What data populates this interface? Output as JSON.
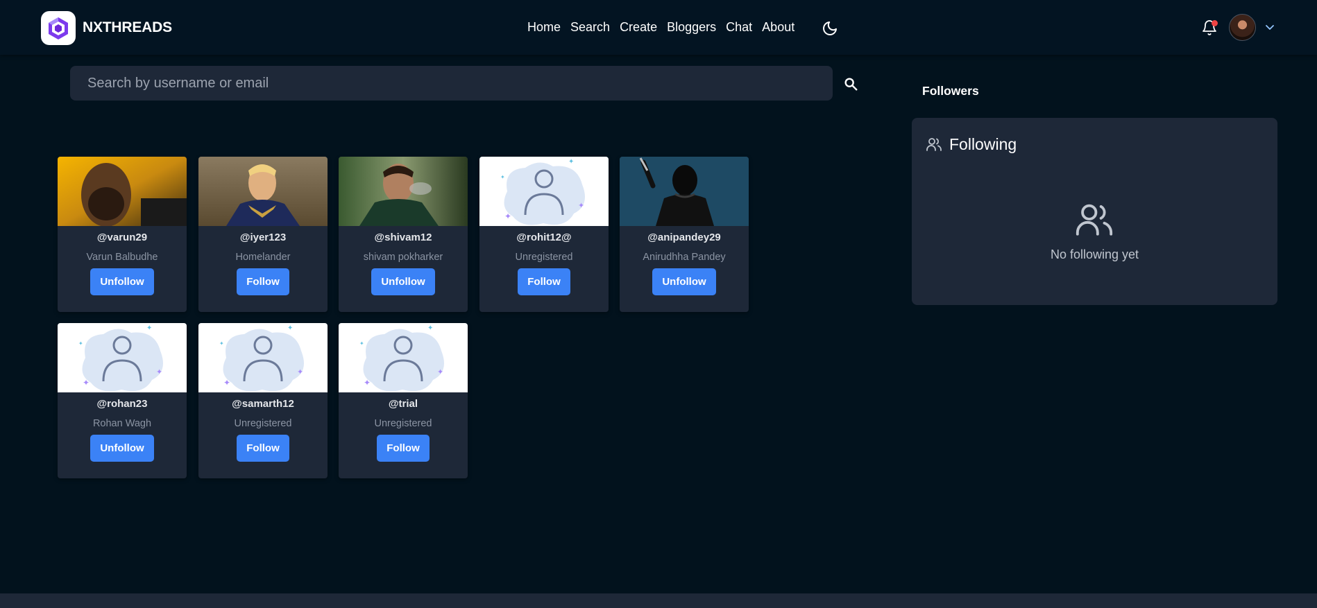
{
  "brand": {
    "name": "NXTHREADS"
  },
  "nav": {
    "links": [
      "Home",
      "Search",
      "Create",
      "Bloggers",
      "Chat",
      "About"
    ]
  },
  "icons": {
    "theme_toggle": "moon-icon",
    "notifications": "bell-icon",
    "menu": "chevron-down-icon",
    "search": "search-icon"
  },
  "search": {
    "placeholder": "Search by username or email",
    "value": ""
  },
  "users": [
    {
      "username": "@varun29",
      "name": "Varun Balbudhe",
      "action": "Unfollow",
      "image": "photo"
    },
    {
      "username": "@iyer123",
      "name": "Homelander",
      "action": "Follow",
      "image": "photo"
    },
    {
      "username": "@shivam12",
      "name": "shivam pokharker",
      "action": "Unfollow",
      "image": "photo"
    },
    {
      "username": "@rohit12@",
      "name": "Unregistered",
      "action": "Follow",
      "image": "placeholder"
    },
    {
      "username": "@anipandey29",
      "name": "Anirudhha Pandey",
      "action": "Unfollow",
      "image": "photo"
    },
    {
      "username": "@rohan23",
      "name": "Rohan Wagh",
      "action": "Unfollow",
      "image": "placeholder"
    },
    {
      "username": "@samarth12",
      "name": "Unregistered",
      "action": "Follow",
      "image": "placeholder"
    },
    {
      "username": "@trial",
      "name": "Unregistered",
      "action": "Follow",
      "image": "placeholder"
    }
  ],
  "sidebar": {
    "followers_title": "Followers",
    "following_title": "Following",
    "empty_text": "No following yet"
  },
  "colors": {
    "background": "#02121d",
    "card": "#1e2838",
    "accent": "#3b82f6",
    "notification_dot": "#ef4444"
  }
}
